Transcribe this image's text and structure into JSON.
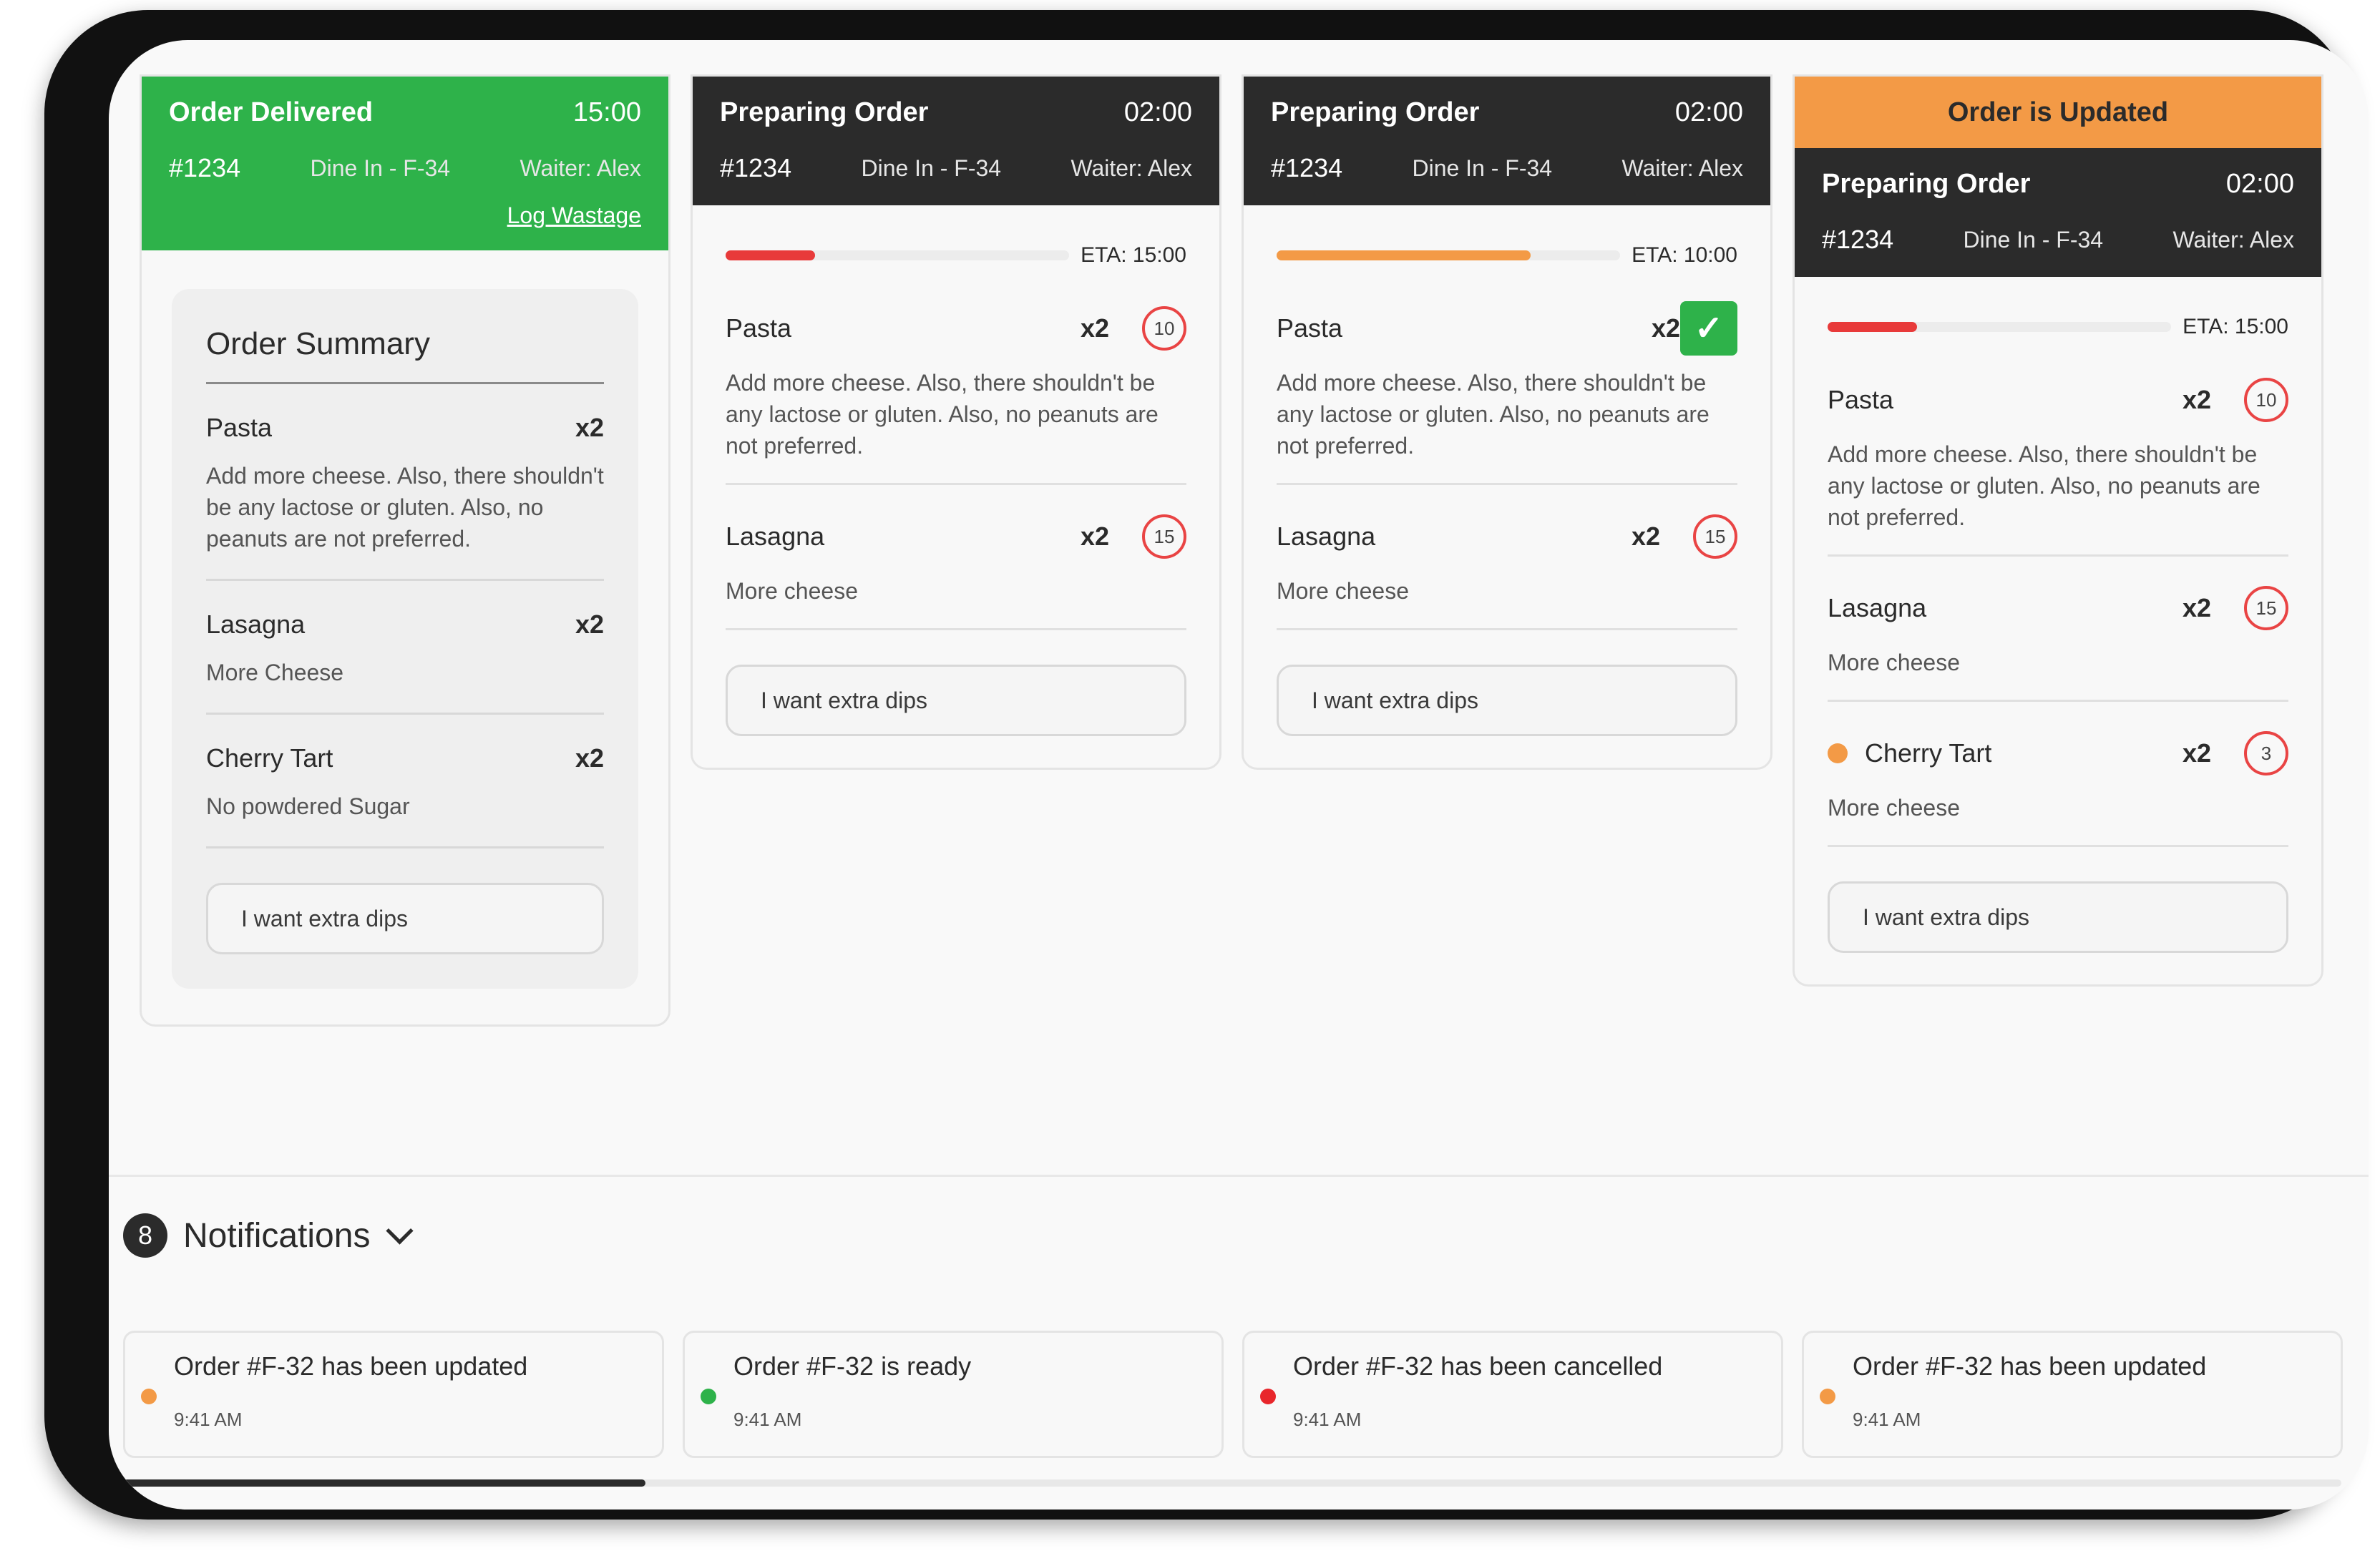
{
  "orders": {
    "delivered": {
      "status": "Order Delivered",
      "time": "15:00",
      "id": "#1234",
      "table": "Dine In - F-34",
      "waiter": "Waiter: Alex",
      "log_wastage": "Log Wastage",
      "summary_title": "Order Summary",
      "items": [
        {
          "name": "Pasta",
          "qty": "x2",
          "note": "Add more cheese. Also, there shouldn't be any lactose or gluten. Also, no peanuts are not preferred."
        },
        {
          "name": "Lasagna",
          "qty": "x2",
          "note": "More Cheese"
        },
        {
          "name": "Cherry Tart",
          "qty": "x2",
          "note": "No powdered Sugar"
        }
      ],
      "request": "I want extra dips"
    },
    "preparing1": {
      "status": "Preparing Order",
      "time": "02:00",
      "id": "#1234",
      "table": "Dine In - F-34",
      "waiter": "Waiter: Alex",
      "eta": "ETA: 15:00",
      "progress": 0.26,
      "progress_color": "#e83a3a",
      "items": [
        {
          "name": "Pasta",
          "qty": "x2",
          "timer": "10",
          "note": "Add more cheese. Also, there shouldn't be any lactose or gluten. Also, no peanuts are not preferred."
        },
        {
          "name": "Lasagna",
          "qty": "x2",
          "timer": "15",
          "note": "More cheese"
        }
      ],
      "request": "I want extra dips"
    },
    "preparing2": {
      "status": "Preparing Order",
      "time": "02:00",
      "id": "#1234",
      "table": "Dine In - F-34",
      "waiter": "Waiter: Alex",
      "eta": "ETA: 10:00",
      "progress": 0.74,
      "progress_color": "#f39a46",
      "items": [
        {
          "name": "Pasta",
          "qty": "x2",
          "status_icon": "check-icon",
          "note": "Add more cheese. Also, there shouldn't be any lactose or gluten. Also, no peanuts are not preferred."
        },
        {
          "name": "Lasagna",
          "qty": "x2",
          "timer": "15",
          "note": "More cheese"
        }
      ],
      "request": "I want extra dips"
    },
    "updated": {
      "banner": "Order is Updated",
      "status": "Preparing Order",
      "time": "02:00",
      "id": "#1234",
      "table": "Dine In - F-34",
      "waiter": "Waiter: Alex",
      "eta": "ETA: 15:00",
      "progress": 0.26,
      "progress_color": "#e83a3a",
      "items": [
        {
          "name": "Pasta",
          "qty": "x2",
          "timer": "10",
          "note": "Add more cheese. Also, there shouldn't be any lactose or gluten. Also, no peanuts are not preferred."
        },
        {
          "name": "Lasagna",
          "qty": "x2",
          "timer": "15",
          "note": "More cheese"
        },
        {
          "name": "Cherry Tart",
          "qty": "x2",
          "timer": "3",
          "note": "More cheese",
          "dot_color": "#f39a46"
        }
      ],
      "request": "I want extra dips"
    }
  },
  "notifications": {
    "count": "8",
    "title": "Notifications",
    "items": [
      {
        "text": "Order #F-32 has been updated",
        "time": "9:41 AM",
        "dot_color": "#f39a46"
      },
      {
        "text": "Order #F-32 is ready",
        "time": "9:41 AM",
        "dot_color": "#2eb24a"
      },
      {
        "text": "Order #F-32 has been cancelled",
        "time": "9:41 AM",
        "dot_color": "#e8262b"
      },
      {
        "text": "Order #F-32 has been updated",
        "time": "9:41 AM",
        "dot_color": "#f39a46"
      }
    ]
  },
  "colors": {
    "green": "#2eb24a",
    "dark": "#2b2b2b",
    "orange": "#f39a46",
    "red": "#e83a3a"
  }
}
